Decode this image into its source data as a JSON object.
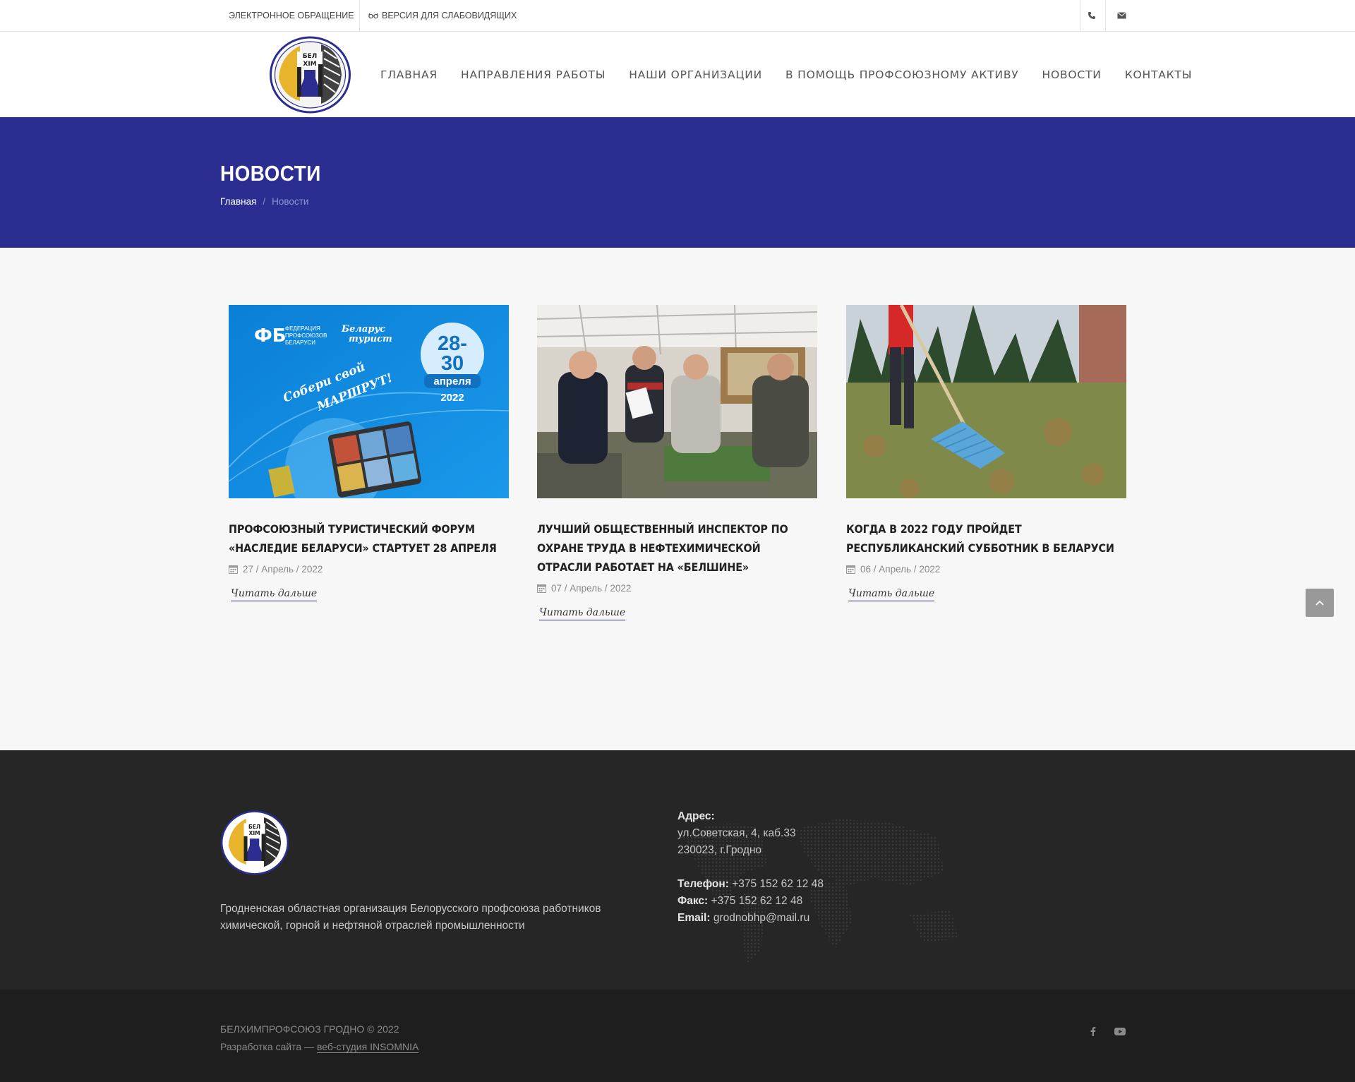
{
  "topbar": {
    "appeal_label": "ЭЛЕКТРОННОЕ ОБРАЩЕНИЕ",
    "vision_label": "ВЕРСИЯ ДЛЯ СЛАБОВИДЯЩИХ",
    "icons": [
      "glasses-icon",
      "phone-icon",
      "mail-icon"
    ]
  },
  "nav": {
    "items": [
      "ГЛАВНАЯ",
      "НАПРАВЛЕНИЯ РАБОТЫ",
      "НАШИ ОРГАНИЗАЦИИ",
      "В ПОМОЩЬ ПРОФСОЮЗНОМУ АКТИВУ",
      "НОВОСТИ",
      "КОНТАКТЫ"
    ]
  },
  "logo": {
    "text_line1": "БЕЛ",
    "text_line2": "ХІМ"
  },
  "page": {
    "title": "НОВОСТИ",
    "breadcrumb": {
      "home": "Главная",
      "separator": "/",
      "current": "Новости"
    }
  },
  "news": [
    {
      "title": "ПРОФСОЮЗНЫЙ ТУРИСТИЧЕСКИЙ ФОРУМ «НАСЛЕДИЕ БЕЛАРУСИ» СТАРТУЕТ 28 АПРЕЛЯ",
      "date": "27 / Апрель / 2022",
      "more": "Читать дальше",
      "image": {
        "org1": "ФЕДЕРАЦИЯ ПРОФСОЮЗОВ БЕЛАРУСИ",
        "org1_l1": "ФЕДЕРАЦИЯ",
        "org1_l2": "ПРОФСОЮЗОВ",
        "org1_l3": "БЕЛАРУСИ",
        "org2_l1": "Беларус",
        "org2_l2": "турист",
        "slogan_l1": "Собери свой",
        "slogan_l2": "МАРШРУТ!",
        "dates_l1": "28-",
        "dates_l2": "30",
        "month": "апреля",
        "year": "2022"
      }
    },
    {
      "title": "ЛУЧШИЙ ОБЩЕСТВЕННЫЙ ИНСПЕКТОР ПО ОХРАНЕ ТРУДА В НЕФТЕХИМИЧЕСКОЙ ОТРАСЛИ РАБОТАЕТ НА «БЕЛШИНЕ»",
      "date": "07 / Апрель / 2022",
      "more": "Читать дальше"
    },
    {
      "title": "КОГДА В 2022 ГОДУ ПРОЙДЕТ РЕСПУБЛИКАНСКИЙ СУББОТНИК В БЕЛАРУСИ",
      "date": "06 / Апрель / 2022",
      "more": "Читать дальше"
    }
  ],
  "footer": {
    "description": "Гродненская областная организация Белорусского профсоюза работников химической, горной и нефтяной отраслей промышленности",
    "address_label": "Адрес:",
    "address_line1": "ул.Советская, 4, каб.33",
    "address_line2": "230023, г.Гродно",
    "phone_label": "Телефон:",
    "phone": "+375 152 62 12 48",
    "fax_label": "Факс:",
    "fax": "+375 152 62 12 48",
    "email_label": "Email:",
    "email": "grodnobhp@mail.ru"
  },
  "bottom": {
    "copyright": "БЕЛХИМПРОФСОЮЗ ГРОДНО © 2022",
    "dev_prefix": "Разработка сайта — ",
    "dev_link": "веб-студия INSOMNIA",
    "social": [
      "facebook-icon",
      "youtube-icon"
    ]
  },
  "colors": {
    "brand_blue": "#2b2e90",
    "footer": "#262626",
    "bottom": "#1e1e1e"
  }
}
